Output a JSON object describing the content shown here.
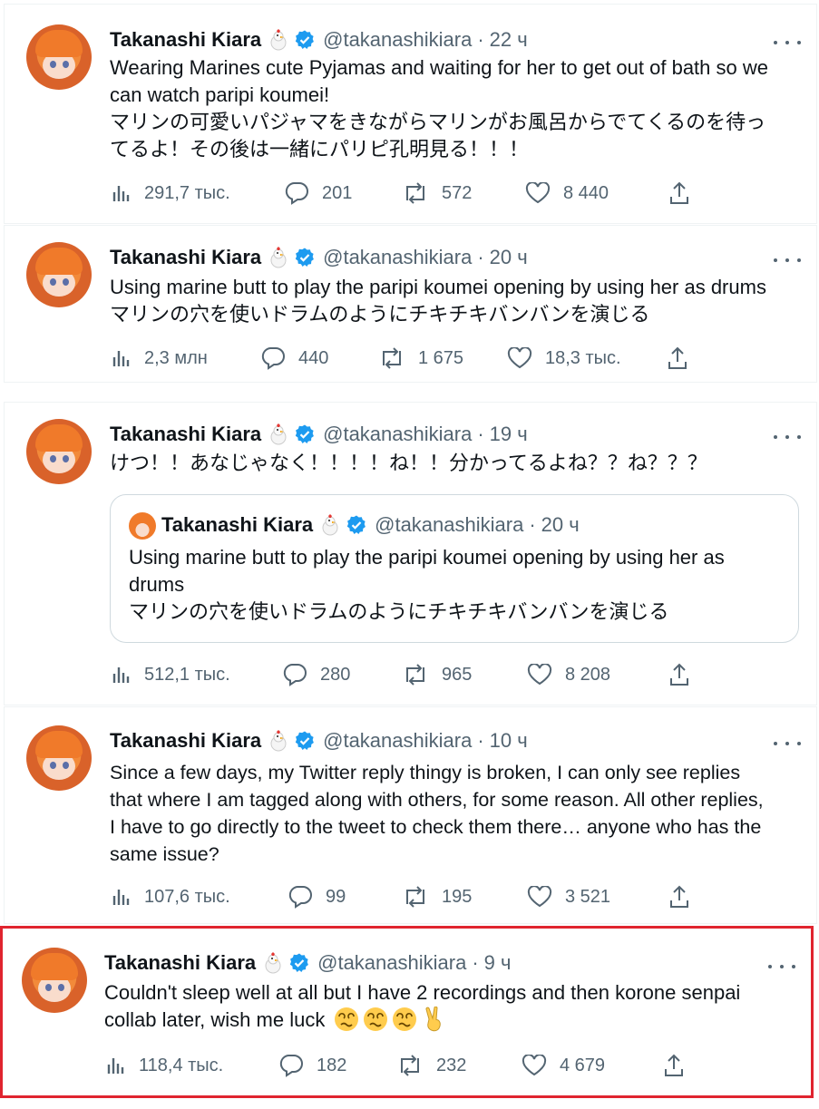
{
  "colors": {
    "accent": "#1d9bf0",
    "text": "#0f1419",
    "muted": "#536471",
    "highlight_border": "#e0242f"
  },
  "tweets": [
    {
      "name": "Takanashi Kiara",
      "handle": "@takanashikiara",
      "time": "22 ч",
      "lines": [
        "Wearing Marines cute Pyjamas and waiting for her to get out of bath so we",
        "can watch paripi koumei!",
        "マリンの可愛いパジャマをきながらマリンがお風呂からでてくるのを待っ",
        "てるよ！その後は一緒にパリピ孔明見る！！！"
      ],
      "views": "291,7 тыс.",
      "replies": "201",
      "retweets": "572",
      "likes": "8 440"
    },
    {
      "name": "Takanashi Kiara",
      "handle": "@takanashikiara",
      "time": "20 ч",
      "lines": [
        "Using marine butt to play the paripi koumei opening by using her as drums",
        "マリンの穴を使いドラムのようにチキチキバンバンを演じる"
      ],
      "views": "2,3 млн",
      "replies": "440",
      "retweets": "1 675",
      "likes": "18,3 тыс."
    },
    {
      "name": "Takanashi Kiara",
      "handle": "@takanashikiara",
      "time": "19 ч",
      "lines": [
        "けつ！！あなじゃなく！！！！ね！！分かってるよね？？ね？？？"
      ],
      "quote": {
        "name": "Takanashi Kiara",
        "handle": "@takanashikiara",
        "time": "20 ч",
        "lines": [
          "Using marine butt to play the paripi koumei opening by using her as",
          "drums",
          "マリンの穴を使いドラムのようにチキチキバンバンを演じる"
        ]
      },
      "views": "512,1 тыс.",
      "replies": "280",
      "retweets": "965",
      "likes": "8 208"
    },
    {
      "name": "Takanashi Kiara",
      "handle": "@takanashikiara",
      "time": "10 ч",
      "lines": [
        "Since a few days, my Twitter reply thingy is broken, I can only see replies",
        "that where I am tagged along with others, for some reason. All other replies,",
        "I have to go directly to the tweet to check them there… anyone who has the",
        "same issue?"
      ],
      "views": "107,6 тыс.",
      "replies": "99",
      "retweets": "195",
      "likes": "3 521"
    },
    {
      "name": "Takanashi Kiara",
      "handle": "@takanashikiara",
      "time": "9 ч",
      "lines": [
        "Couldn't sleep well at all but I have 2 recordings and then korone senpai",
        "collab later, wish me luck"
      ],
      "emoji": [
        "dizzy-face-emoji",
        "dizzy-face-emoji",
        "dizzy-face-emoji",
        "victory-hand-emoji"
      ],
      "views": "118,4 тыс.",
      "replies": "182",
      "retweets": "232",
      "likes": "4 679"
    }
  ]
}
